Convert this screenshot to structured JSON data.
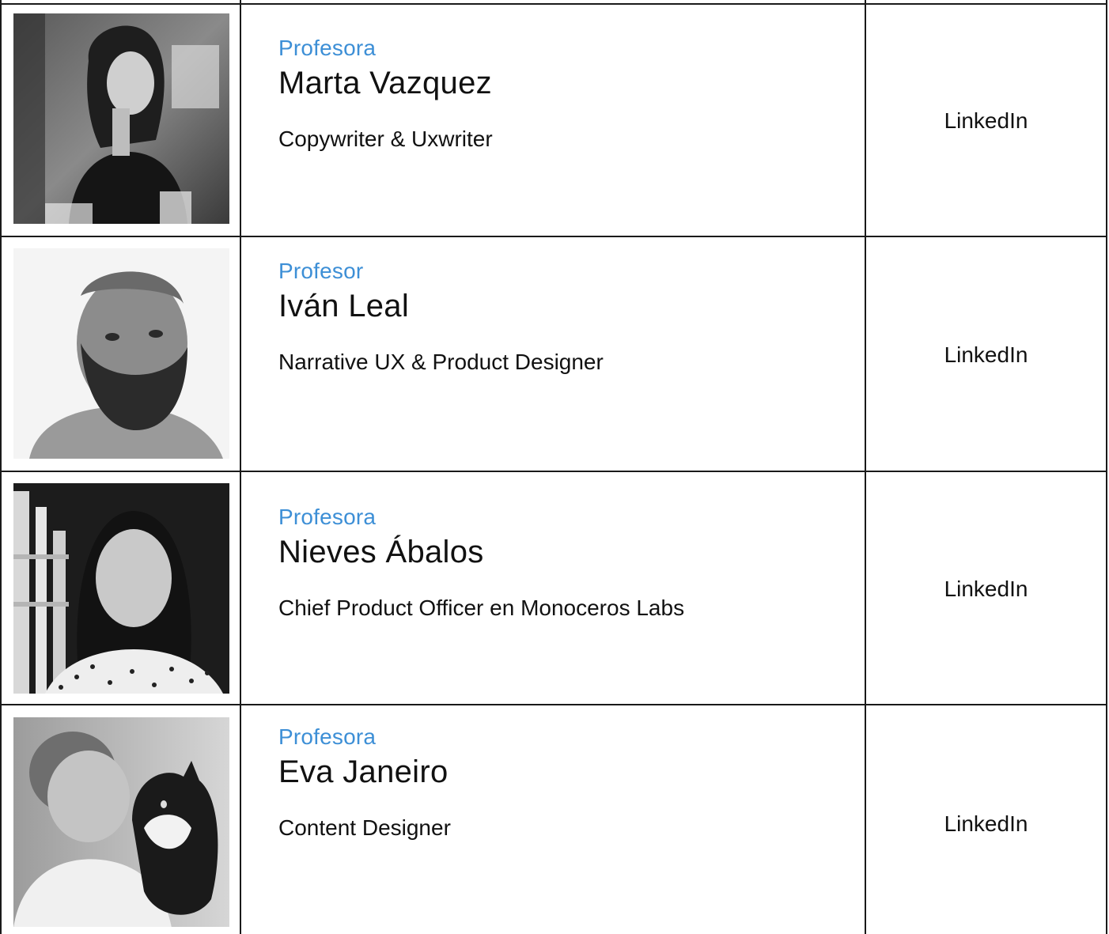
{
  "rows": [
    {
      "role": "Profesora",
      "name": "Marta Vazquez",
      "job": "Copywriter & Uxwriter",
      "link": "LinkedIn"
    },
    {
      "role": "Profesor",
      "name": "Iván Leal",
      "job": "Narrative UX & Product Designer",
      "link": "LinkedIn"
    },
    {
      "role": "Profesora",
      "name": "Nieves Ábalos",
      "job": "Chief Product Officer en Monoceros Labs",
      "link": "LinkedIn"
    },
    {
      "role": "Profesora",
      "name": "Eva Janeiro",
      "job": "Content Designer",
      "link": "LinkedIn"
    }
  ],
  "colors": {
    "role_accent": "#3d8fd6",
    "border": "#1a1a1a",
    "text": "#111111"
  }
}
